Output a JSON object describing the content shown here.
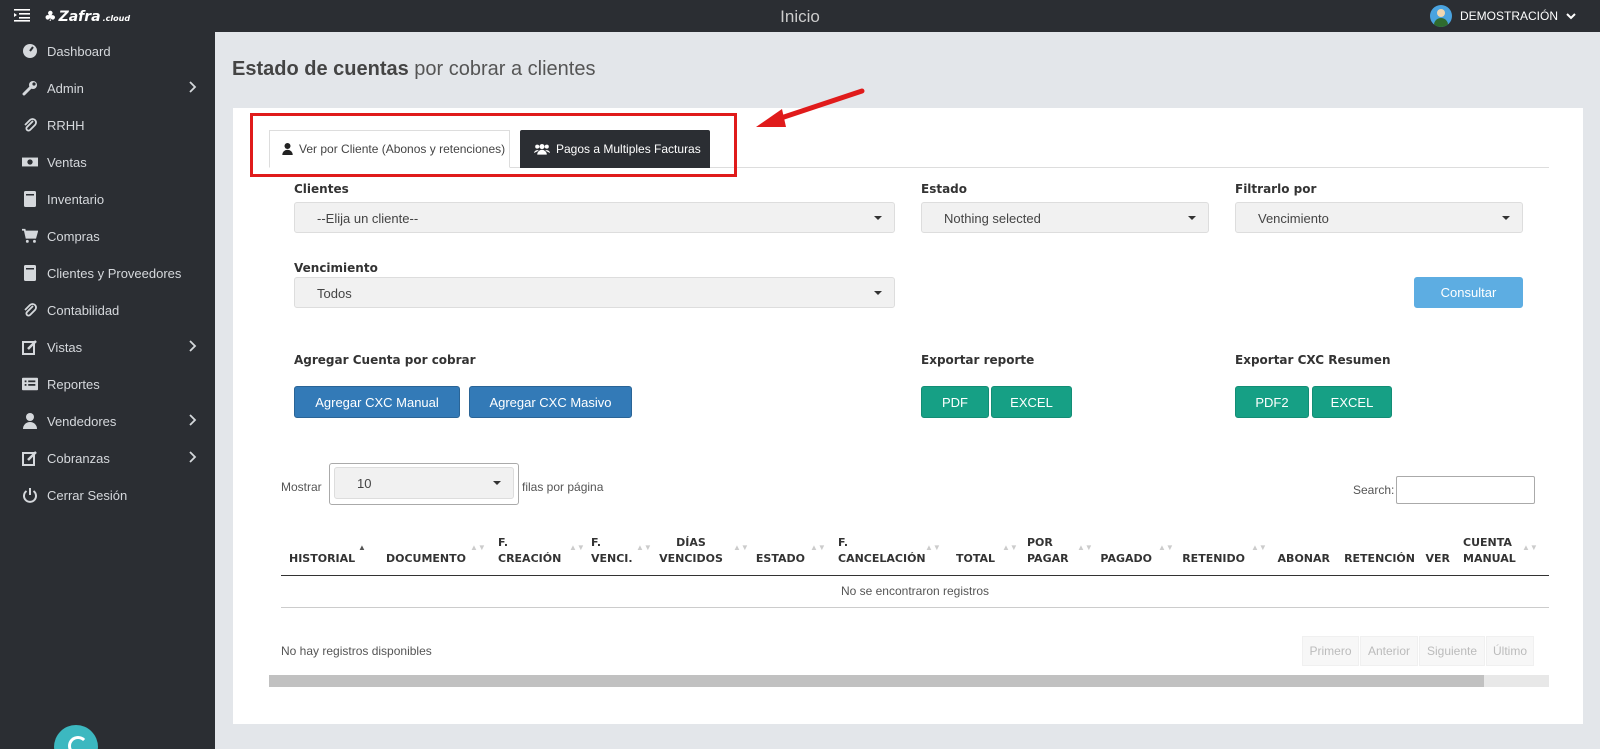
{
  "header": {
    "logo": "Zafra",
    "logo_suffix": ".cloud",
    "title": "Inicio",
    "user": "DEMOSTRACIÓN"
  },
  "sidebar": {
    "items": [
      {
        "label": "Dashboard",
        "icon": "dashboard-icon",
        "has_submenu": false
      },
      {
        "label": "Admin",
        "icon": "wrench-icon",
        "has_submenu": true
      },
      {
        "label": "RRHH",
        "icon": "paperclip-icon",
        "has_submenu": false
      },
      {
        "label": "Ventas",
        "icon": "money-icon",
        "has_submenu": false
      },
      {
        "label": "Inventario",
        "icon": "book-icon",
        "has_submenu": false
      },
      {
        "label": "Compras",
        "icon": "cart-icon",
        "has_submenu": false
      },
      {
        "label": "Clientes y Proveedores",
        "icon": "book-icon",
        "has_submenu": false
      },
      {
        "label": "Contabilidad",
        "icon": "paperclip-icon",
        "has_submenu": false
      },
      {
        "label": "Vistas",
        "icon": "edit-icon",
        "has_submenu": true
      },
      {
        "label": "Reportes",
        "icon": "list-icon",
        "has_submenu": false
      },
      {
        "label": "Vendedores",
        "icon": "user-icon",
        "has_submenu": true
      },
      {
        "label": "Cobranzas",
        "icon": "edit-icon",
        "has_submenu": true
      },
      {
        "label": "Cerrar Sesión",
        "icon": "power-icon",
        "has_submenu": false
      }
    ]
  },
  "page": {
    "title_bold": "Estado de cuentas",
    "title_light": "por cobrar a clientes"
  },
  "tabs": [
    {
      "label": "Ver por Cliente (Abonos y retenciones)",
      "icon": "user-icon",
      "active": true
    },
    {
      "label": "Pagos a Multiples Facturas",
      "icon": "users-icon",
      "active": false
    }
  ],
  "filters": {
    "clientes_label": "Clientes",
    "clientes_value": "--Elija un cliente--",
    "estado_label": "Estado",
    "estado_value": "Nothing selected",
    "filtrar_label": "Filtrarlo por",
    "filtrar_value": "Vencimiento",
    "vencimiento_label": "Vencimiento",
    "vencimiento_value": "Todos",
    "consultar": "Consultar"
  },
  "actions": {
    "agregar_label": "Agregar Cuenta por cobrar",
    "agregar_manual": "Agregar CXC Manual",
    "agregar_masivo": "Agregar CXC Masivo",
    "exportar_label": "Exportar reporte",
    "pdf": "PDF",
    "excel": "EXCEL",
    "resumen_label": "Exportar CXC Resumen",
    "pdf2": "PDF2",
    "excel2": "EXCEL"
  },
  "table": {
    "show_label": "Mostrar",
    "page_size": "10",
    "rows_label": "filas por página",
    "search_label": "Search:",
    "columns": [
      {
        "line1": "",
        "line2": "HISTORIAL"
      },
      {
        "line1": "",
        "line2": "DOCUMENTO"
      },
      {
        "line1": "F.",
        "line2": "CREACIÓN"
      },
      {
        "line1": "F.",
        "line2": "VENCI."
      },
      {
        "line1": "DÍAS",
        "line2": "VENCIDOS"
      },
      {
        "line1": "",
        "line2": "ESTADO"
      },
      {
        "line1": "F.",
        "line2": "CANCELACIÓN"
      },
      {
        "line1": "",
        "line2": "TOTAL"
      },
      {
        "line1": "POR",
        "line2": "PAGAR"
      },
      {
        "line1": "",
        "line2": "PAGADO"
      },
      {
        "line1": "",
        "line2": "RETENIDO"
      },
      {
        "line1": "",
        "line2": "ABONAR"
      },
      {
        "line1": "",
        "line2": "RETENCIÓN"
      },
      {
        "line1": "",
        "line2": "VER"
      },
      {
        "line1": "CUENTA",
        "line2": "MANUAL"
      }
    ],
    "empty": "No se encontraron registros",
    "info": "No hay registros disponibles",
    "pager": [
      "Primero",
      "Anterior",
      "Siguiente",
      "Último"
    ]
  },
  "colors": {
    "sidebar_bg": "#2b2e33",
    "primary_blue": "#337ab7",
    "green": "#16a085",
    "light_blue": "#5dade2",
    "highlight_red": "#e01b1b"
  }
}
